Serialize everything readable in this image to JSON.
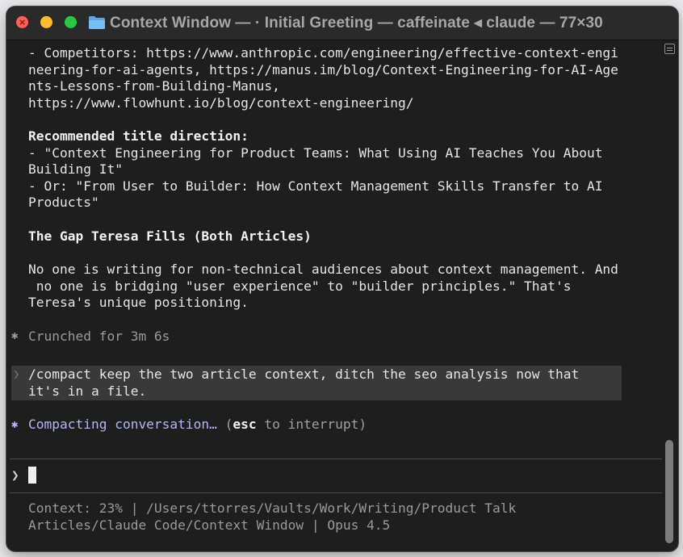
{
  "window": {
    "title": "Context Window —  · Initial Greeting — caffeinate ◂ claude — 77×30"
  },
  "colors": {
    "background": "#1e1e1e",
    "titlebar": "#2a2a2a",
    "text": "#e6e6e6",
    "accent_lavender": "#b5b7f5",
    "close": "#ff5f57",
    "minimize": "#febc2e",
    "maximize": "#28c840"
  },
  "icons": {
    "folder": "folder-icon",
    "crunched_star": "asterisk-icon",
    "compacting_star": "asterisk-icon",
    "prompt": "chevron-right-icon",
    "scroll_toggle": "list-toggle-icon"
  },
  "output": {
    "competitors_line1": "- Competitors: https://www.anthropic.com/engineering/effective-context-engi",
    "competitors_line2": "neering-for-ai-agents, https://manus.im/blog/Context-Engineering-for-AI-Age",
    "competitors_line3": "nts-Lessons-from-Building-Manus,",
    "competitors_line4": "https://www.flowhunt.io/blog/context-engineering/",
    "title_heading": "Recommended title direction:",
    "title_opt1_line1": "- \"Context Engineering for Product Teams: What Using AI Teaches You About",
    "title_opt1_line2": "Building It\"",
    "title_opt2_line1": "- Or: \"From User to Builder: How Context Management Skills Transfer to AI",
    "title_opt2_line2": "Products\"",
    "gap_heading": "The Gap Teresa Fills (Both Articles)",
    "gap_line1": "No one is writing for non-technical audiences about context management. And",
    "gap_line2": " no one is bridging \"user experience\" to \"builder principles.\" That's",
    "gap_line3": "Teresa's unique positioning."
  },
  "status": {
    "star": "✱",
    "crunched": "Crunched for 3m 6s"
  },
  "user_prompt": {
    "caret": "❯",
    "line1": "/compact keep the two article context, ditch the seo analysis now that",
    "line2": "it's in a file."
  },
  "compacting": {
    "star": "✱",
    "label": "Compacting conversation…",
    "paren_open": " (",
    "key": "esc",
    "rest": " to interrupt)"
  },
  "input": {
    "caret": "❯",
    "value": ""
  },
  "footer": {
    "line1": "Context: 23% | /Users/ttorres/Vaults/Work/Writing/Product Talk",
    "line2": "Articles/Claude Code/Context Window | Opus 4.5"
  }
}
